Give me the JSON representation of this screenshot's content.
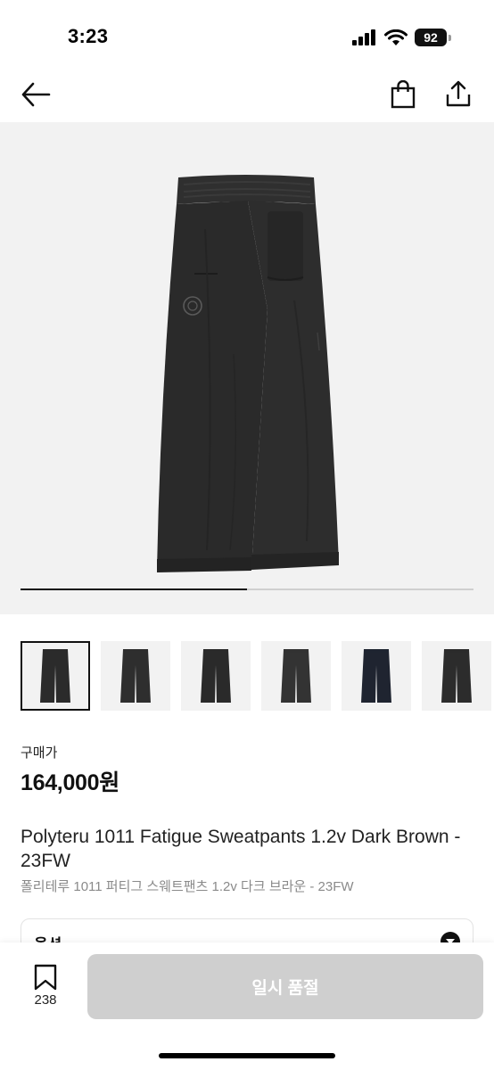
{
  "status_bar": {
    "time": "3:23",
    "battery": "92",
    "icons": [
      "signal-icon",
      "wifi-icon",
      "battery-icon"
    ]
  },
  "nav": {
    "icons": [
      "back-arrow-icon",
      "shopping-bag-icon",
      "share-icon"
    ]
  },
  "gallery": {
    "thumbnails": [
      {
        "color": "#2b2b2b",
        "selected": true
      },
      {
        "color": "#2e2e2e",
        "selected": false
      },
      {
        "color": "#2a2a2a",
        "selected": false
      },
      {
        "color": "#333333",
        "selected": false
      },
      {
        "color": "#1f2430",
        "selected": false
      },
      {
        "color": "#2c2c2c",
        "selected": false
      }
    ],
    "progress": 0.5
  },
  "product": {
    "price_label": "구매가",
    "price": "164,000원",
    "title_en": "Polyteru 1011 Fatigue Sweatpants 1.2v Dark Brown - 23FW",
    "title_ko": "폴리테루 1011 퍼티그 스웨트팬츠 1.2v 다크 브라운 - 23FW"
  },
  "option": {
    "label": "옵션"
  },
  "bottom": {
    "wish_count": "238",
    "soldout_label": "일시 품절"
  },
  "colors": {
    "accent": "#111111",
    "disabled_button": "#cfcfcf",
    "image_bg": "#f2f2f2"
  }
}
